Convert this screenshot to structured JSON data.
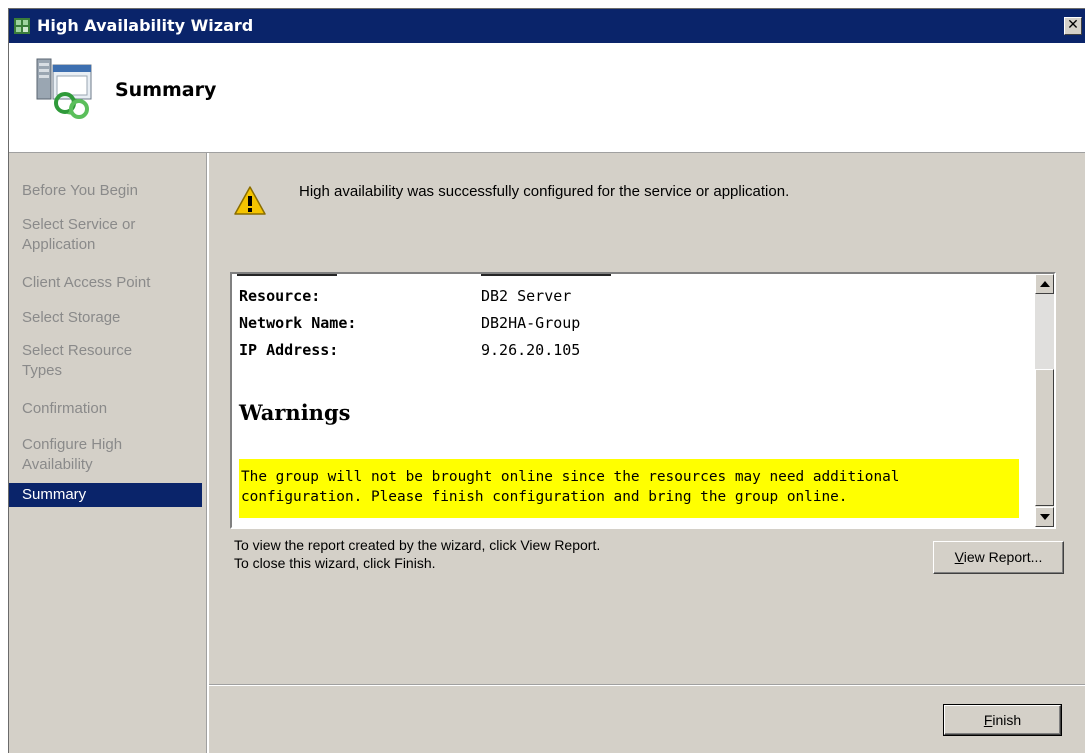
{
  "window": {
    "title": "High Availability Wizard"
  },
  "header": {
    "title": "Summary"
  },
  "sidebar": {
    "items": [
      {
        "label": "Before You Begin"
      },
      {
        "label": "Select Service or Application"
      },
      {
        "label": "Client Access Point"
      },
      {
        "label": "Select Storage"
      },
      {
        "label": "Select Resource Types"
      },
      {
        "label": "Confirmation"
      },
      {
        "label": "Configure High Availability"
      },
      {
        "label": "Summary",
        "active": true
      }
    ]
  },
  "status": {
    "message": "High availability was successfully configured for the service or application."
  },
  "report": {
    "rows": [
      {
        "label": "Resource:",
        "value": "DB2 Server"
      },
      {
        "label": "Network Name:",
        "value": "DB2HA-Group"
      },
      {
        "label": "IP Address:",
        "value": "9.26.20.105"
      }
    ],
    "warnings_heading": "Warnings",
    "warning_line1": "The group will not be brought online since the resources may need additional",
    "warning_line2": "configuration. Please finish configuration and bring the group online."
  },
  "hints": {
    "line1": "To view the report created by the wizard, click View Report.",
    "line2": "To close this wizard, click Finish."
  },
  "buttons": {
    "view_report_pre": "",
    "view_report_acc": "V",
    "view_report_post": "iew Report...",
    "finish_acc": "F",
    "finish_post": "inish"
  },
  "icons": {
    "window": "wizard-icon",
    "header": "cluster-server-icon",
    "status": "warning-icon"
  },
  "colors": {
    "titlebar": "#0a246a",
    "selection": "#0a246a",
    "highlight": "#ffff00"
  }
}
